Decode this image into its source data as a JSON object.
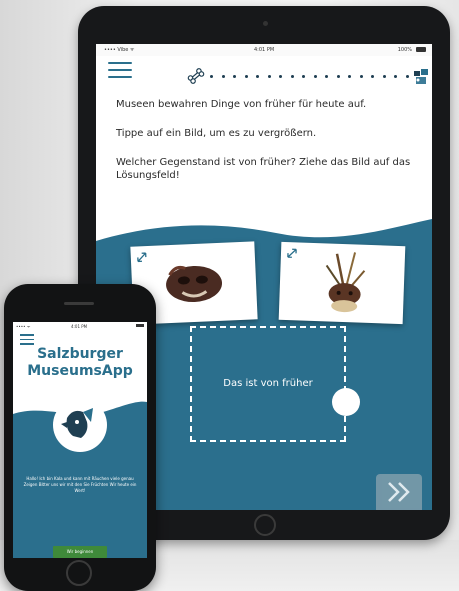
{
  "colors": {
    "accent_blue": "#2a6f8c",
    "dark_navy": "#1f3f52",
    "start_green": "#3f8a3a"
  },
  "tablet": {
    "status": {
      "carrier": "•••• Vibe ᯤ",
      "time": "4:01 PM",
      "battery": "100%"
    },
    "icons": {
      "menu": "hamburger-menu-icon",
      "progress_start": "bone-icon",
      "progress_goal": "goal-icon",
      "card_expand": "expand-arrows-icon",
      "next": "double-chevron-right-icon"
    },
    "progress_dots": 18,
    "instructions": [
      "Museen bewahren Dinge von früher für heute auf.",
      "Tippe auf ein Bild, um es zu vergrößern.",
      "Welcher Gegenstand ist von früher? Ziehe das Bild auf das Lösungsfeld!"
    ],
    "drop_zone_label": "Das ist von früher"
  },
  "phone": {
    "status": {
      "carrier": "•••• ᯤ",
      "time": "4:01 PM"
    },
    "app_title_line1": "Salzburger",
    "app_title_line2": "MuseumsApp",
    "intro_text": "Hallo! Ich bin Kala und kann mit Räuchen viele genau Zeigen Bitter uns wir mit den Sie Früchten Wir heute ein Wert!",
    "start_button": "Wir beginnen"
  }
}
